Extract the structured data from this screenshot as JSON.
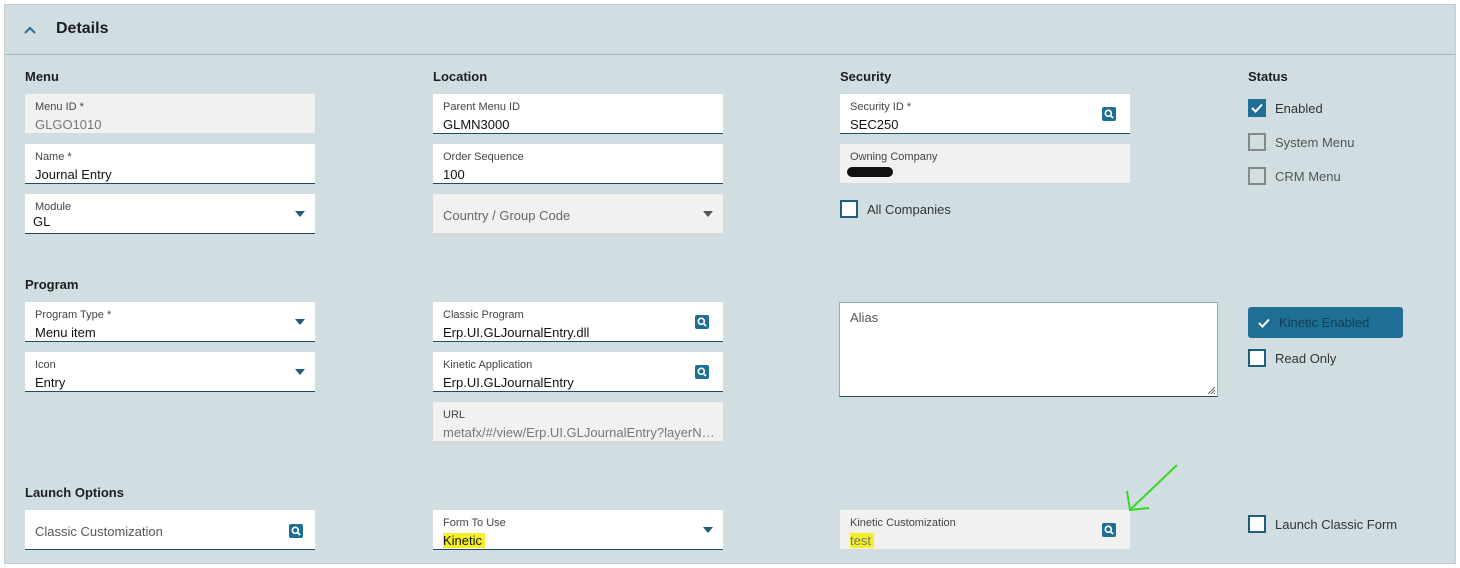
{
  "header": {
    "title": "Details"
  },
  "sections": {
    "menu": "Menu",
    "location": "Location",
    "security": "Security",
    "status": "Status",
    "program": "Program",
    "launch": "Launch Options"
  },
  "fields": {
    "menu_id": {
      "label": "Menu ID *",
      "value": "GLGO1010"
    },
    "name": {
      "label": "Name *",
      "value": "Journal Entry"
    },
    "module": {
      "label": "Module",
      "value": "GL"
    },
    "parent_menu_id": {
      "label": "Parent Menu ID",
      "value": "GLMN3000"
    },
    "order_sequence": {
      "label": "Order Sequence",
      "value": "100"
    },
    "country_group_code": {
      "placeholder": "Country / Group Code"
    },
    "security_id": {
      "label": "Security ID *",
      "value": "SEC250"
    },
    "owning_company": {
      "label": "Owning Company",
      "value": ""
    },
    "program_type": {
      "label": "Program Type *",
      "value": "Menu item"
    },
    "icon": {
      "label": "Icon",
      "value": "Entry"
    },
    "classic_program": {
      "label": "Classic Program",
      "value": "Erp.UI.GLJournalEntry.dll"
    },
    "kinetic_application": {
      "label": "Kinetic Application",
      "value": "Erp.UI.GLJournalEntry"
    },
    "url": {
      "label": "URL",
      "value": "metafx/#/view/Erp.UI.GLJournalEntry?layerName=test"
    },
    "alias": {
      "placeholder": "Alias"
    },
    "classic_customization": {
      "placeholder": "Classic Customization"
    },
    "form_to_use": {
      "label": "Form To Use",
      "value": "Kinetic"
    },
    "kinetic_customization": {
      "label": "Kinetic Customization",
      "value": "test"
    }
  },
  "checkboxes": {
    "enabled": {
      "label": "Enabled",
      "checked": true
    },
    "system_menu": {
      "label": "System Menu",
      "checked": false
    },
    "crm_menu": {
      "label": "CRM Menu",
      "checked": false
    },
    "all_companies": {
      "label": "All Companies",
      "checked": false
    },
    "read_only": {
      "label": "Read Only",
      "checked": false
    },
    "launch_classic_form": {
      "label": "Launch Classic Form",
      "checked": false
    }
  },
  "toggle": {
    "kinetic_enabled": {
      "label": "Kinetic Enabled",
      "checked": true
    }
  },
  "icons": {
    "collapse": "chevron-up-icon",
    "dropdown": "chevron-down-icon",
    "lookup": "search-icon",
    "check": "check-icon"
  },
  "colors": {
    "panel_bg": "#d0dee2",
    "accent": "#1f6f95",
    "highlight": "#f5ef2a",
    "annotation_arrow": "#3ad52a"
  }
}
